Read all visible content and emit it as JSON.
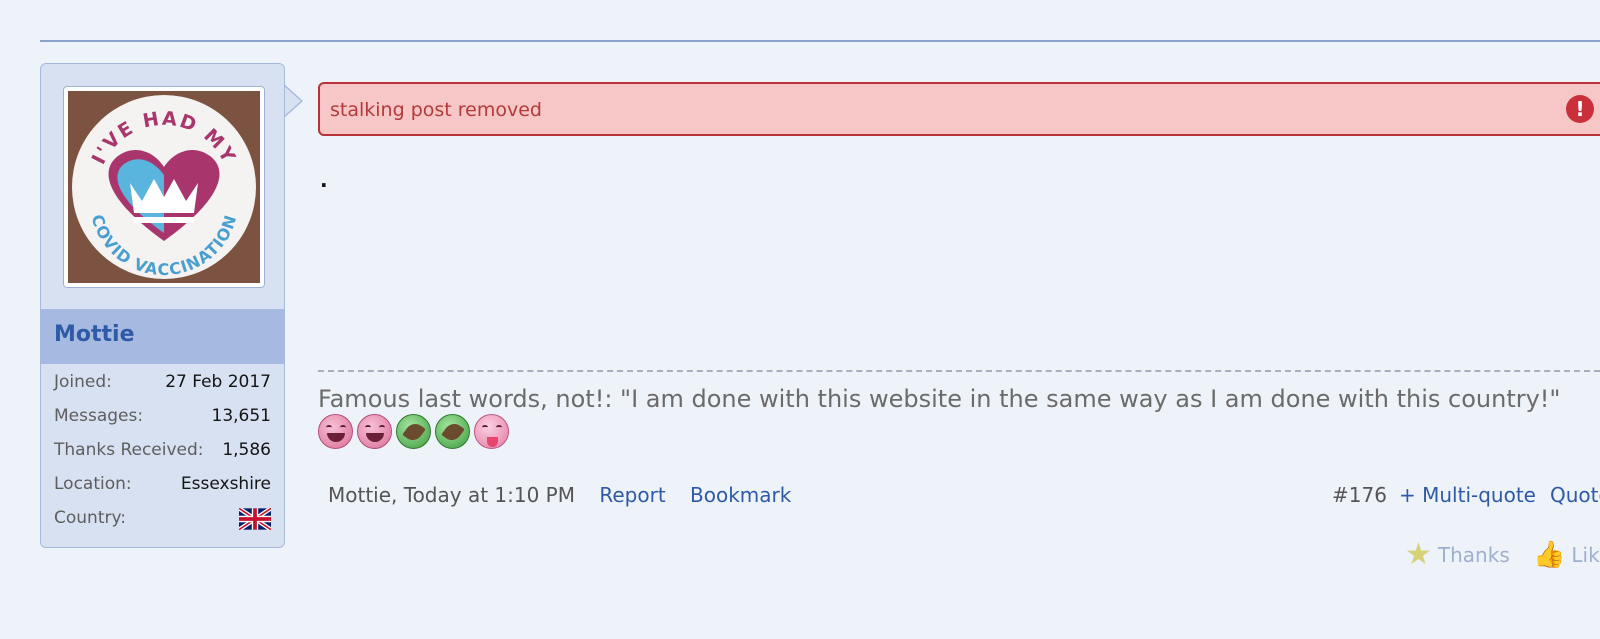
{
  "user": {
    "name": "Mottie",
    "avatar_text": {
      "top": "I'VE HAD MY",
      "bottom": "COVID VACCINATION"
    },
    "stats": [
      {
        "label": "Joined:",
        "value": "27 Feb 2017"
      },
      {
        "label": "Messages:",
        "value": "13,651"
      },
      {
        "label": "Thanks Received:",
        "value": "1,586"
      },
      {
        "label": "Location:",
        "value": "Essexshire"
      }
    ],
    "country_label": "Country:",
    "country_flag": "uk-flag-icon"
  },
  "post": {
    "mod_notice": "stalking post removed",
    "body": ".",
    "signature": "Famous last words, not!: \"I am done with this website in the same way as I am done with this country!\"",
    "smileys": [
      "laughing-smiley-icon",
      "laughing-smiley-icon",
      "green-smiley-icon",
      "green-smiley-icon",
      "tongue-smiley-icon"
    ]
  },
  "meta": {
    "author_time": "Mottie, Today at 1:10 PM",
    "report": "Report",
    "bookmark": "Bookmark",
    "post_number": "#176",
    "multiquote": "+ Multi-quote",
    "quote": "Quote"
  },
  "reactions": {
    "thanks": "Thanks",
    "like": "Like"
  },
  "colors": {
    "page_bg": "#eef2f9",
    "link": "#2f5aa6",
    "mod_bg": "#f7c6c6",
    "mod_border": "#b8323a",
    "username": "#3b5fa8"
  }
}
